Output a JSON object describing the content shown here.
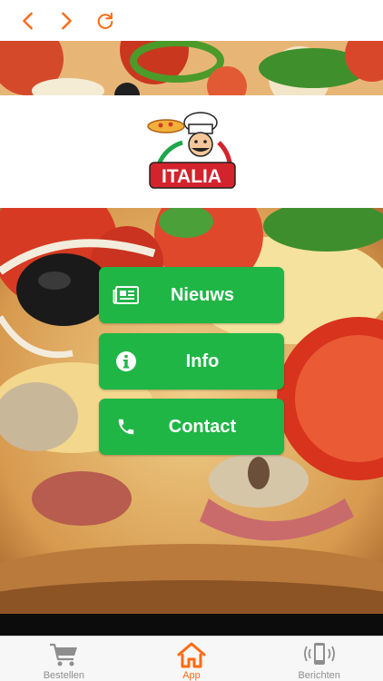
{
  "colors": {
    "accent": "#ff6a13",
    "button_green": "#1fb646",
    "tab_inactive": "#8e8e8e"
  },
  "topbar": {
    "back_icon": "chevron-left-icon",
    "forward_icon": "chevron-right-icon",
    "reload_icon": "reload-icon"
  },
  "logo": {
    "text": "ITALIA"
  },
  "menu": {
    "items": [
      {
        "label": "Nieuws",
        "icon": "newspaper-icon"
      },
      {
        "label": "Info",
        "icon": "info-icon"
      },
      {
        "label": "Contact",
        "icon": "phone-icon"
      }
    ]
  },
  "tabbar": {
    "items": [
      {
        "label": "Bestellen",
        "icon": "cart-icon",
        "active": false
      },
      {
        "label": "App",
        "icon": "home-icon",
        "active": true
      },
      {
        "label": "Berichten",
        "icon": "phone-vibrate-icon",
        "active": false
      }
    ]
  }
}
